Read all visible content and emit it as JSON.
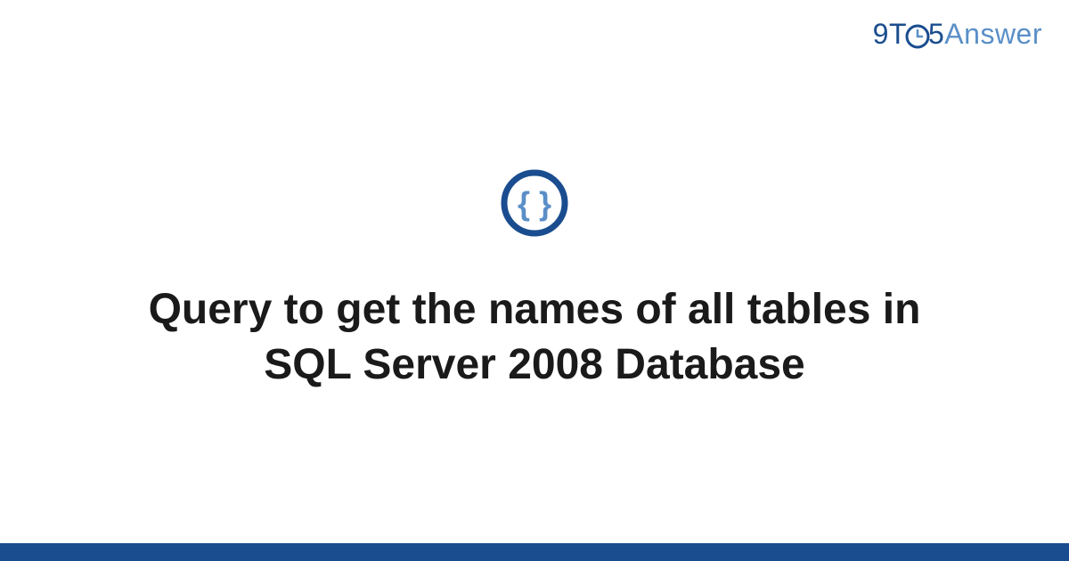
{
  "brand": {
    "part1": "9T",
    "part2": "5",
    "part3": "Answer"
  },
  "question": {
    "title": "Query to get the names of all tables in SQL Server 2008 Database"
  },
  "colors": {
    "primary": "#1a4d8f",
    "secondary": "#5a8fc7",
    "text": "#1a1a1a"
  }
}
